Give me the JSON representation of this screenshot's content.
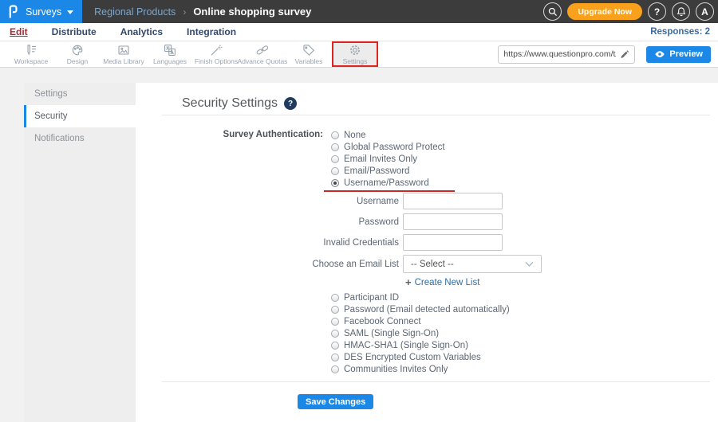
{
  "header": {
    "logo_text": "P",
    "app_menu_label": "Surveys",
    "breadcrumb_folder": "Regional Products",
    "breadcrumb_separator": "›",
    "breadcrumb_title": "Online shopping survey",
    "upgrade_label": "Upgrade Now",
    "help_badge": "?",
    "avatar_initial": "A"
  },
  "nav": {
    "tabs": [
      "Edit",
      "Distribute",
      "Analytics",
      "Integration"
    ],
    "active_tab": "Edit",
    "responses_label": "Responses: 2"
  },
  "toolbar": {
    "items": [
      {
        "label": "Workspace",
        "icon": "workspace-icon"
      },
      {
        "label": "Design",
        "icon": "design-icon"
      },
      {
        "label": "Media Library",
        "icon": "media-library-icon"
      },
      {
        "label": "Languages",
        "icon": "languages-icon"
      },
      {
        "label": "Finish Options",
        "icon": "finish-options-icon"
      },
      {
        "label": "Advance Quotas",
        "icon": "advance-quotas-icon"
      },
      {
        "label": "Variables",
        "icon": "variables-icon"
      },
      {
        "label": "Settings",
        "icon": "settings-icon",
        "active": true,
        "annotated": true
      }
    ],
    "survey_url": "https://www.questionpro.com/t/APNrFZ",
    "preview_label": "Preview"
  },
  "sidebar": {
    "items": [
      {
        "label": "Settings",
        "active": false
      },
      {
        "label": "Security",
        "active": true
      },
      {
        "label": "Notifications",
        "active": false
      }
    ]
  },
  "content": {
    "title": "Security Settings",
    "help_badge": "?",
    "auth_label": "Survey Authentication:",
    "auth_options": [
      "None",
      "Global Password Protect",
      "Email Invites Only",
      "Email/Password",
      "Username/Password"
    ],
    "auth_selected": "Username/Password",
    "fields": [
      {
        "label": "Username",
        "value": ""
      },
      {
        "label": "Password",
        "value": ""
      },
      {
        "label": "Invalid Credentials",
        "value": ""
      }
    ],
    "email_list_label": "Choose an Email List",
    "email_list_value": "-- Select --",
    "create_list_label": "Create New List",
    "more_auth_options": [
      "Participant ID",
      "Password (Email detected automatically)",
      "Facebook Connect",
      "SAML (Single Sign-On)",
      "HMAC-SHA1 (Single Sign-On)",
      "DES Encrypted Custom Variables",
      "Communities Invites Only"
    ],
    "save_label": "Save Changes"
  },
  "colors": {
    "accent_blue": "#1b87e6",
    "upgrade_orange": "#f9a11c",
    "annotation_red": "#dd2420",
    "active_tab_red": "#9c3036",
    "topbar_dark": "#3c3c3c"
  }
}
